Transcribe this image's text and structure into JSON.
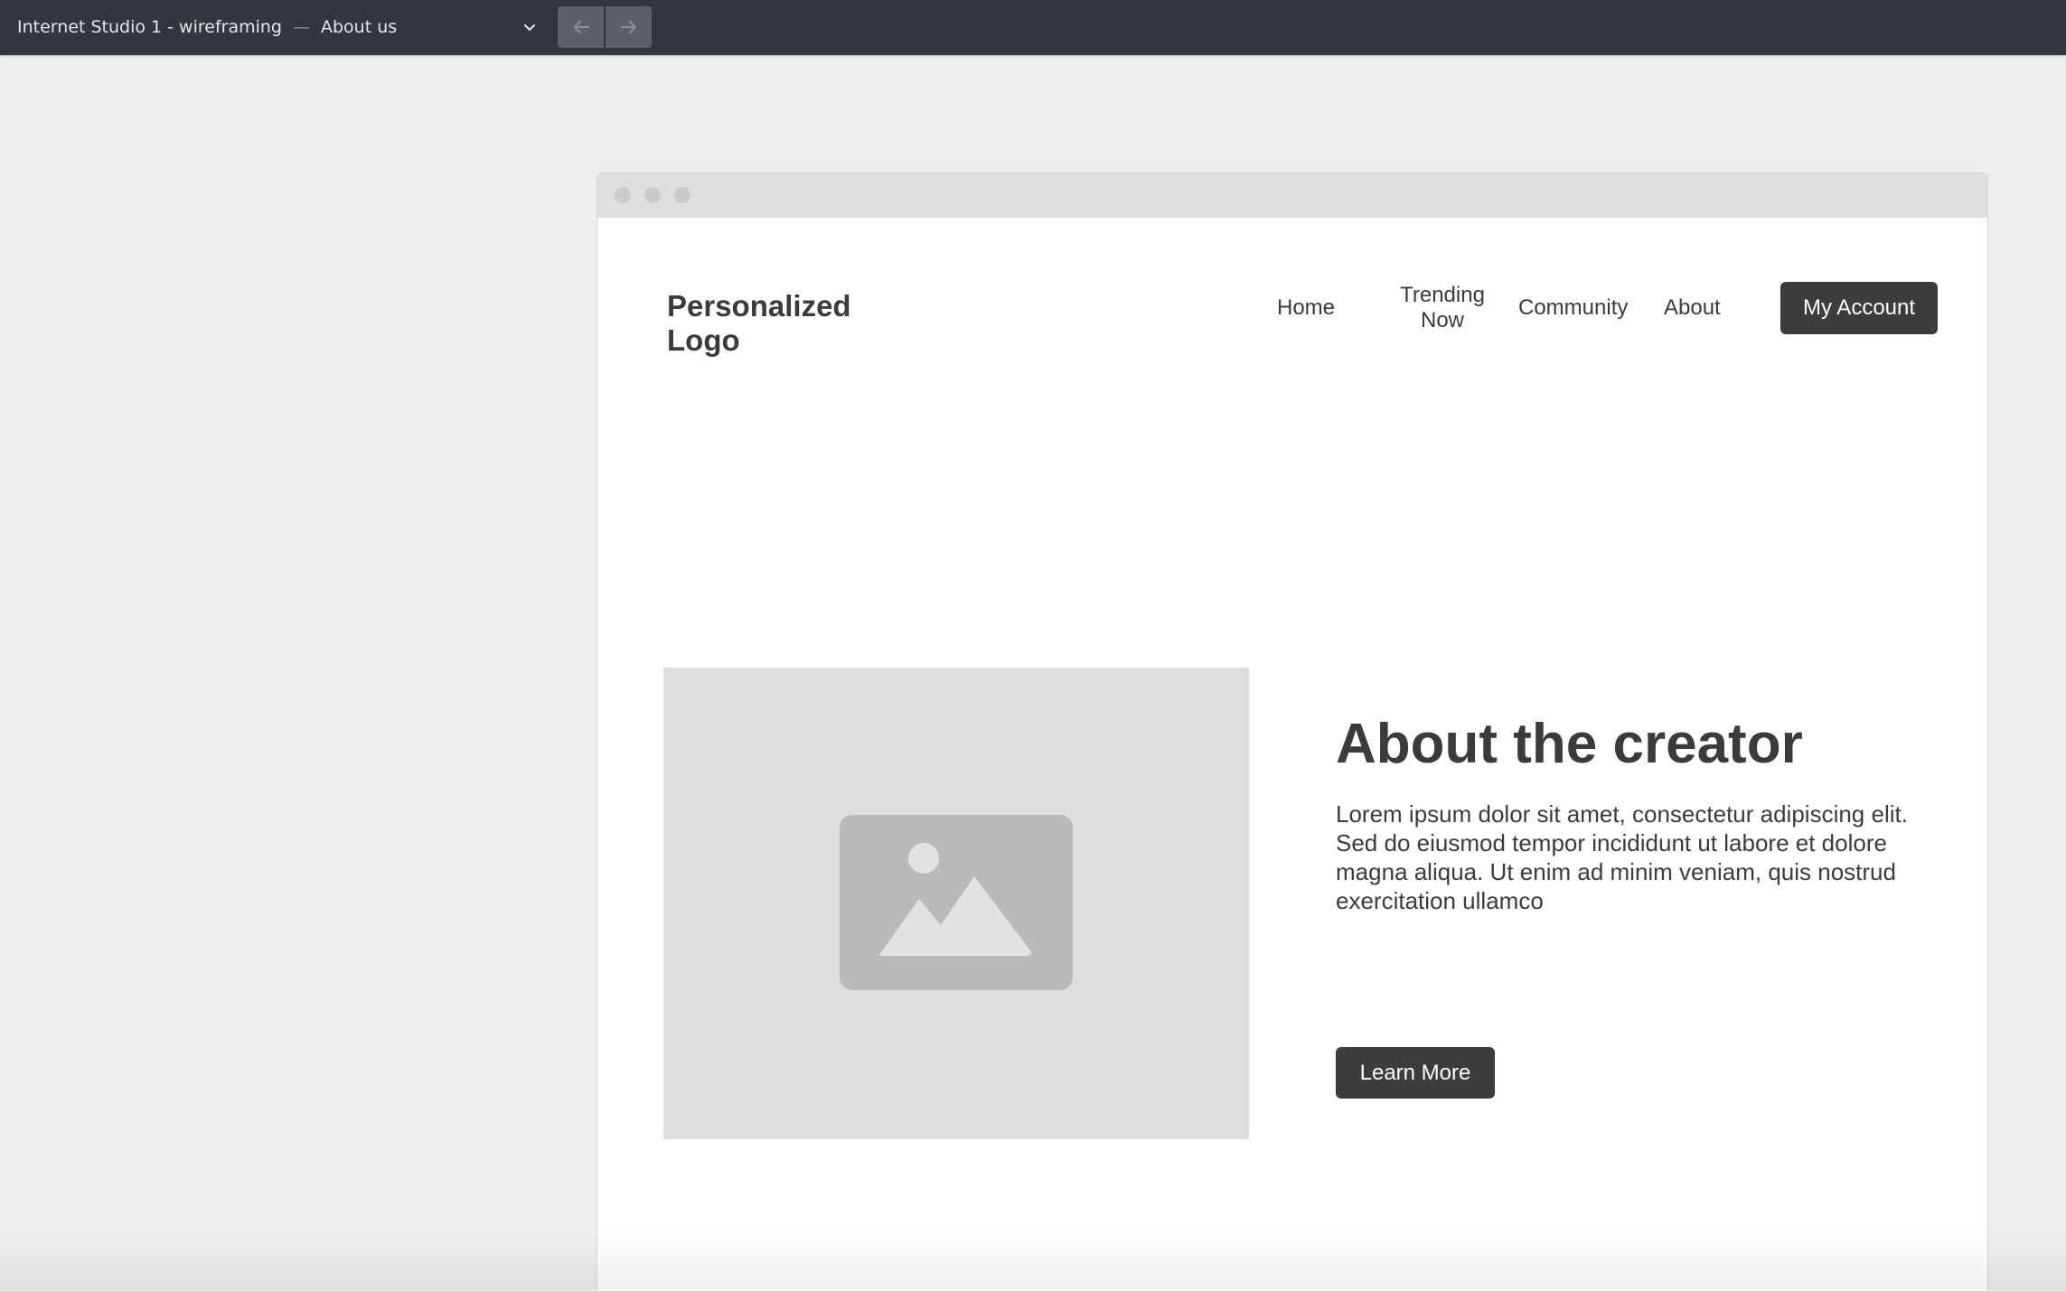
{
  "toolbar": {
    "project_title": "Internet Studio 1 - wireframing",
    "separator": "—",
    "page_name": "About us",
    "dropdown_icon": "chevron-down-icon",
    "back_icon": "arrow-left-icon",
    "forward_icon": "arrow-right-icon"
  },
  "site": {
    "logo_line1": "Personalized",
    "logo_line2": "Logo",
    "nav": {
      "home": "Home",
      "trending_line1": "Trending",
      "trending_line2": "Now",
      "community": "Community",
      "about": "About"
    },
    "account_button": "My Account",
    "hero": {
      "image_icon": "image-placeholder-icon",
      "heading": "About the creator",
      "paragraph": "Lorem ipsum dolor sit amet, consectetur adipiscing elit. Sed do eiusmod tempor incididunt ut labore et dolore magna aliqua. Ut enim ad minim veniam, quis nostrud exercitation ullamco",
      "button": "Learn More"
    }
  },
  "colors": {
    "toolbar_bg": "#323640",
    "canvas_bg": "#eeeeee",
    "dark_button": "#3c3c3c",
    "text": "#3b3b3b",
    "placeholder": "#dedede"
  }
}
